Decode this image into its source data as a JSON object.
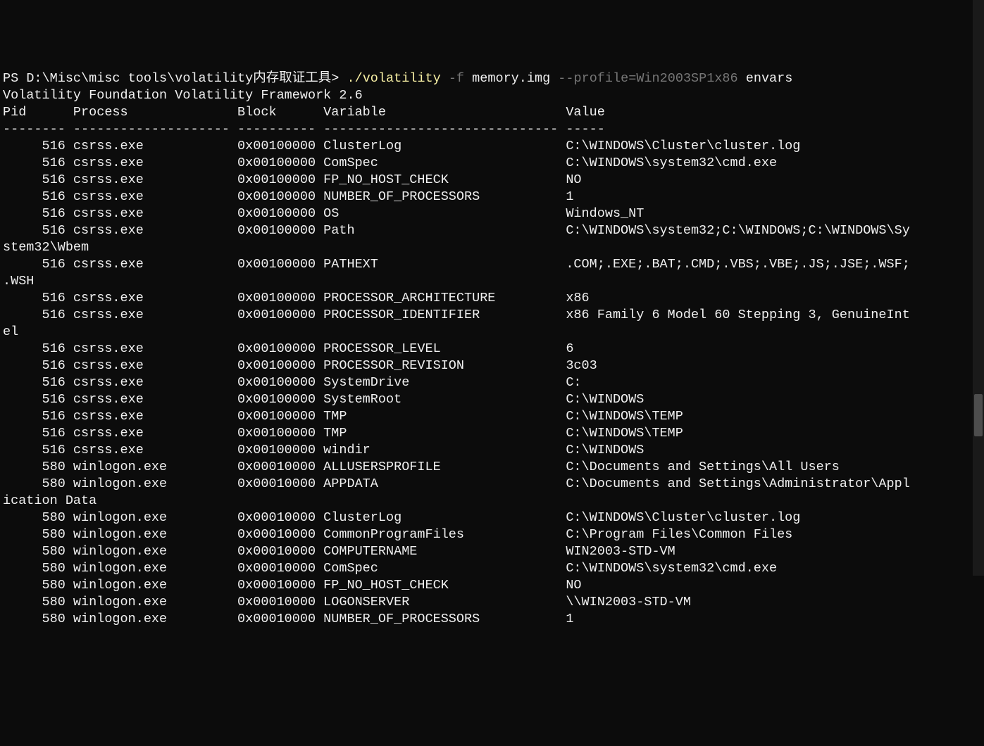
{
  "prompt": {
    "ps": "PS ",
    "path": "D:\\Misc\\misc tools\\volatility内存取证工具>",
    "space1": " ",
    "exe": "./volatility",
    "space2": " ",
    "flag_f": "-f",
    "space3": " ",
    "img": "memory.img",
    "space4": " ",
    "flag_profile": "--profile=Win2003SP1x86",
    "space5": " ",
    "cmd": "envars"
  },
  "banner": "Volatility Foundation Volatility Framework 2.6",
  "header": {
    "pid": "Pid",
    "process": "Process",
    "block": "Block",
    "variable": "Variable",
    "value": "Value"
  },
  "divider": {
    "pid": "--------",
    "process": "--------------------",
    "block": "----------",
    "variable": "------------------------------",
    "value": "-----"
  },
  "cols": {
    "pid": 8,
    "process": 20,
    "block": 10,
    "variable": 30
  },
  "rows": [
    {
      "pid": "516",
      "process": "csrss.exe",
      "block": "0x00100000",
      "var": "ClusterLog",
      "val": "C:\\WINDOWS\\Cluster\\cluster.log"
    },
    {
      "pid": "516",
      "process": "csrss.exe",
      "block": "0x00100000",
      "var": "ComSpec",
      "val": "C:\\WINDOWS\\system32\\cmd.exe"
    },
    {
      "pid": "516",
      "process": "csrss.exe",
      "block": "0x00100000",
      "var": "FP_NO_HOST_CHECK",
      "val": "NO"
    },
    {
      "pid": "516",
      "process": "csrss.exe",
      "block": "0x00100000",
      "var": "NUMBER_OF_PROCESSORS",
      "val": "1"
    },
    {
      "pid": "516",
      "process": "csrss.exe",
      "block": "0x00100000",
      "var": "OS",
      "val": "Windows_NT"
    },
    {
      "pid": "516",
      "process": "csrss.exe",
      "block": "0x00100000",
      "var": "Path",
      "val": "C:\\WINDOWS\\system32;C:\\WINDOWS;C:\\WINDOWS\\System32\\Wbem"
    },
    {
      "pid": "516",
      "process": "csrss.exe",
      "block": "0x00100000",
      "var": "PATHEXT",
      "val": ".COM;.EXE;.BAT;.CMD;.VBS;.VBE;.JS;.JSE;.WSF;.WSH"
    },
    {
      "pid": "516",
      "process": "csrss.exe",
      "block": "0x00100000",
      "var": "PROCESSOR_ARCHITECTURE",
      "val": "x86"
    },
    {
      "pid": "516",
      "process": "csrss.exe",
      "block": "0x00100000",
      "var": "PROCESSOR_IDENTIFIER",
      "val": "x86 Family 6 Model 60 Stepping 3, GenuineIntel"
    },
    {
      "pid": "516",
      "process": "csrss.exe",
      "block": "0x00100000",
      "var": "PROCESSOR_LEVEL",
      "val": "6"
    },
    {
      "pid": "516",
      "process": "csrss.exe",
      "block": "0x00100000",
      "var": "PROCESSOR_REVISION",
      "val": "3c03"
    },
    {
      "pid": "516",
      "process": "csrss.exe",
      "block": "0x00100000",
      "var": "SystemDrive",
      "val": "C:"
    },
    {
      "pid": "516",
      "process": "csrss.exe",
      "block": "0x00100000",
      "var": "SystemRoot",
      "val": "C:\\WINDOWS"
    },
    {
      "pid": "516",
      "process": "csrss.exe",
      "block": "0x00100000",
      "var": "TMP",
      "val": "C:\\WINDOWS\\TEMP"
    },
    {
      "pid": "516",
      "process": "csrss.exe",
      "block": "0x00100000",
      "var": "TMP",
      "val": "C:\\WINDOWS\\TEMP"
    },
    {
      "pid": "516",
      "process": "csrss.exe",
      "block": "0x00100000",
      "var": "windir",
      "val": "C:\\WINDOWS"
    },
    {
      "pid": "580",
      "process": "winlogon.exe",
      "block": "0x00010000",
      "var": "ALLUSERSPROFILE",
      "val": "C:\\Documents and Settings\\All Users"
    },
    {
      "pid": "580",
      "process": "winlogon.exe",
      "block": "0x00010000",
      "var": "APPDATA",
      "val": "C:\\Documents and Settings\\Administrator\\Application Data"
    },
    {
      "pid": "580",
      "process": "winlogon.exe",
      "block": "0x00010000",
      "var": "ClusterLog",
      "val": "C:\\WINDOWS\\Cluster\\cluster.log"
    },
    {
      "pid": "580",
      "process": "winlogon.exe",
      "block": "0x00010000",
      "var": "CommonProgramFiles",
      "val": "C:\\Program Files\\Common Files"
    },
    {
      "pid": "580",
      "process": "winlogon.exe",
      "block": "0x00010000",
      "var": "COMPUTERNAME",
      "val": "WIN2003-STD-VM"
    },
    {
      "pid": "580",
      "process": "winlogon.exe",
      "block": "0x00010000",
      "var": "ComSpec",
      "val": "C:\\WINDOWS\\system32\\cmd.exe"
    },
    {
      "pid": "580",
      "process": "winlogon.exe",
      "block": "0x00010000",
      "var": "FP_NO_HOST_CHECK",
      "val": "NO"
    },
    {
      "pid": "580",
      "process": "winlogon.exe",
      "block": "0x00010000",
      "var": "LOGONSERVER",
      "val": "\\\\WIN2003-STD-VM"
    },
    {
      "pid": "580",
      "process": "winlogon.exe",
      "block": "0x00010000",
      "var": "NUMBER_OF_PROCESSORS",
      "val": "1"
    }
  ],
  "wrap_width": 116
}
